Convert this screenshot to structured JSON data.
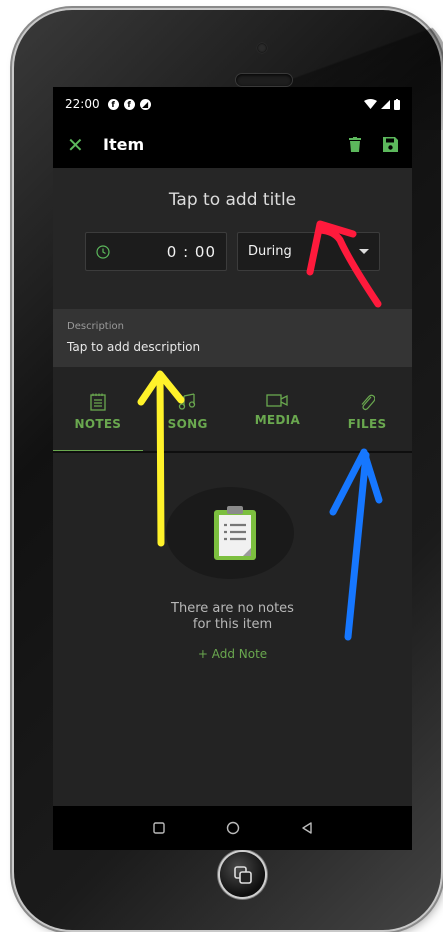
{
  "status_bar": {
    "time": "22:00",
    "notification_icons": [
      "facebook-icon",
      "facebook-icon",
      "app-icon"
    ],
    "right_icons": [
      "wifi-icon",
      "signal-icon",
      "battery-icon"
    ]
  },
  "app_bar": {
    "title": "Item",
    "close_icon": "close-icon",
    "actions": [
      "delete-icon",
      "save-icon"
    ]
  },
  "header": {
    "title_placeholder": "Tap to add title",
    "time_value": "0 : 00",
    "timing_select": "During"
  },
  "description": {
    "label": "Description",
    "placeholder": "Tap to add description"
  },
  "tabs": [
    {
      "label": "NOTES",
      "icon": "notes-icon",
      "active": true
    },
    {
      "label": "SONG",
      "icon": "music-icon",
      "active": false
    },
    {
      "label": "MEDIA",
      "icon": "video-icon",
      "active": false
    },
    {
      "label": "FILES",
      "icon": "paperclip-icon",
      "active": false
    }
  ],
  "empty_state": {
    "line1": "There are no notes",
    "line2": "for this item",
    "add_note": "+  Add Note"
  },
  "colors": {
    "accent": "#6aa84f",
    "red_annotation": "#ff1a3c",
    "yellow_annotation": "#fff22a",
    "blue_annotation": "#1677ff"
  }
}
